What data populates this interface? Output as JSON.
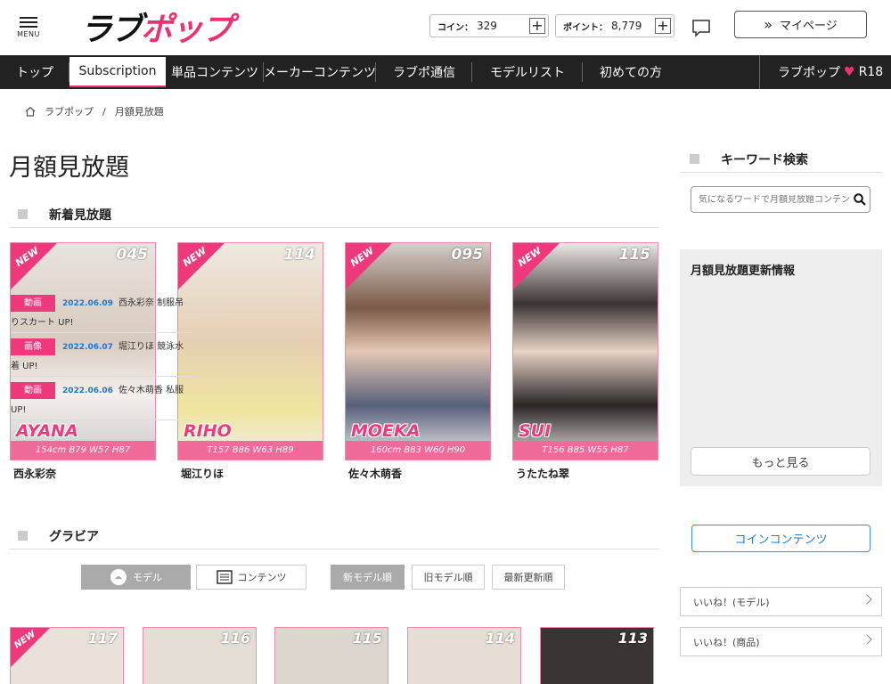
{
  "header": {
    "menu_label": "MENU",
    "logo_black": "ラブ",
    "logo_pink": "ポップ",
    "coin_label": "コイン：",
    "coin_value": "329",
    "point_label": "ポイント：",
    "point_value": "8,779",
    "plus": "+",
    "mypage_label": "マイページ",
    "mypage_icon": "»"
  },
  "nav": {
    "items": [
      "トップ",
      "Subscription",
      "単品コンテンツ",
      "メーカーコンテンツ",
      "ラブポ通信",
      "モデルリスト",
      "初めての方"
    ],
    "active": "Subscription",
    "right_label": "ラブポップ",
    "right_suffix": "R18"
  },
  "breadcrumb": {
    "home": "ラブポップ",
    "separator": "/",
    "current": "月額見放題"
  },
  "page_title": "月額見放題",
  "section_new": "新着見放題",
  "new_badge": "NEW",
  "models": [
    {
      "num": "045",
      "name": "AYANA",
      "stats": "154cm B79 W57 H87",
      "jp_name": "西永彩奈",
      "bg": "#d9cfc7"
    },
    {
      "num": "114",
      "name": "RIHO",
      "stats": "T157 B86 W63 H89",
      "jp_name": "堀江りほ",
      "bg": "#e8d8c3"
    },
    {
      "num": "095",
      "name": "MOEKA",
      "stats": "160cm B83 W60 H90",
      "jp_name": "佐々木萌香",
      "bg": "#c9c3bf"
    },
    {
      "num": "115",
      "name": "SUI",
      "stats": "T156 B85 W55 H87",
      "jp_name": "うたたね翠",
      "bg": "#dcd6d3"
    }
  ],
  "section_gravure": "グラビア",
  "filters": {
    "model": "モデル",
    "contents": "コンテンツ",
    "sort_new": "新モデル順",
    "sort_old": "旧モデル順",
    "sort_updated": "最新更新順"
  },
  "gravure_nums": [
    "117",
    "116",
    "115",
    "114",
    "113"
  ],
  "sidebar": {
    "search_title": "キーワード検索",
    "search_placeholder": "気になるワードで月額見放題コンテンツを検索",
    "news_title": "月額見放題更新情報",
    "news": [
      {
        "tag": "動画",
        "date": "2022.06.09",
        "text": "西永彩奈 制服吊りスカート UP!"
      },
      {
        "tag": "画像",
        "date": "2022.06.07",
        "text": "堀江りほ 競泳水着 UP!"
      },
      {
        "tag": "動画",
        "date": "2022.06.06",
        "text": "佐々木萌香 私服 UP!"
      }
    ],
    "more": "もっと見る",
    "coin_contents": "コインコンテンツ",
    "like_model": "いいね！(モデル)",
    "like_item": "いいね！(商品)"
  },
  "colors": {
    "brand_pink": "#ee2f72",
    "nav_bg": "#222222",
    "link_blue": "#1a78d6"
  }
}
